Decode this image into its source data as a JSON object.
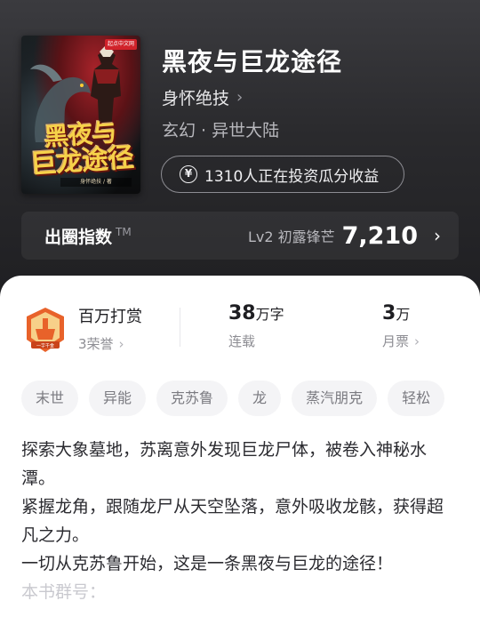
{
  "book": {
    "title": "黑夜与巨龙途径",
    "author": "身怀绝技",
    "genre": "玄幻 · 异世大陆",
    "investors": "1310人正在投资瓜分收益",
    "cover": {
      "publisher_badge": "起点中文网",
      "title_line1": "黑夜与",
      "title_line2": "巨龙途径",
      "subtitle": "身怀绝技 / 著"
    }
  },
  "index_bar": {
    "label": "出圈指数",
    "tm": "TM",
    "level": "Lv2 初露锋芒",
    "score": "7,210"
  },
  "stats": {
    "reward_title": "百万打赏",
    "reward_sub": "3荣誉",
    "medal_text": "一字千金",
    "words_num": "38",
    "words_unit": "万字",
    "words_caption": "连载",
    "tickets_num": "3",
    "tickets_unit": "万",
    "tickets_caption": "月票"
  },
  "tags": [
    "末世",
    "异能",
    "克苏鲁",
    "龙",
    "蒸汽朋克",
    "轻松"
  ],
  "synopsis": {
    "p1": "探索大象墓地，苏离意外发现巨龙尸体，被卷入神秘水潭。",
    "p2": "紧握龙角，跟随龙尸从天空坠落，意外吸收龙骸，获得超凡之力。",
    "p3": "一切从克苏鲁开始，这是一条黑夜与巨龙的途径！",
    "p4": "本书群号："
  },
  "colors": {
    "hero_bg": "#2a2a2d",
    "accent_gold": "#f6d24a",
    "medal_orange": "#e8622a"
  }
}
